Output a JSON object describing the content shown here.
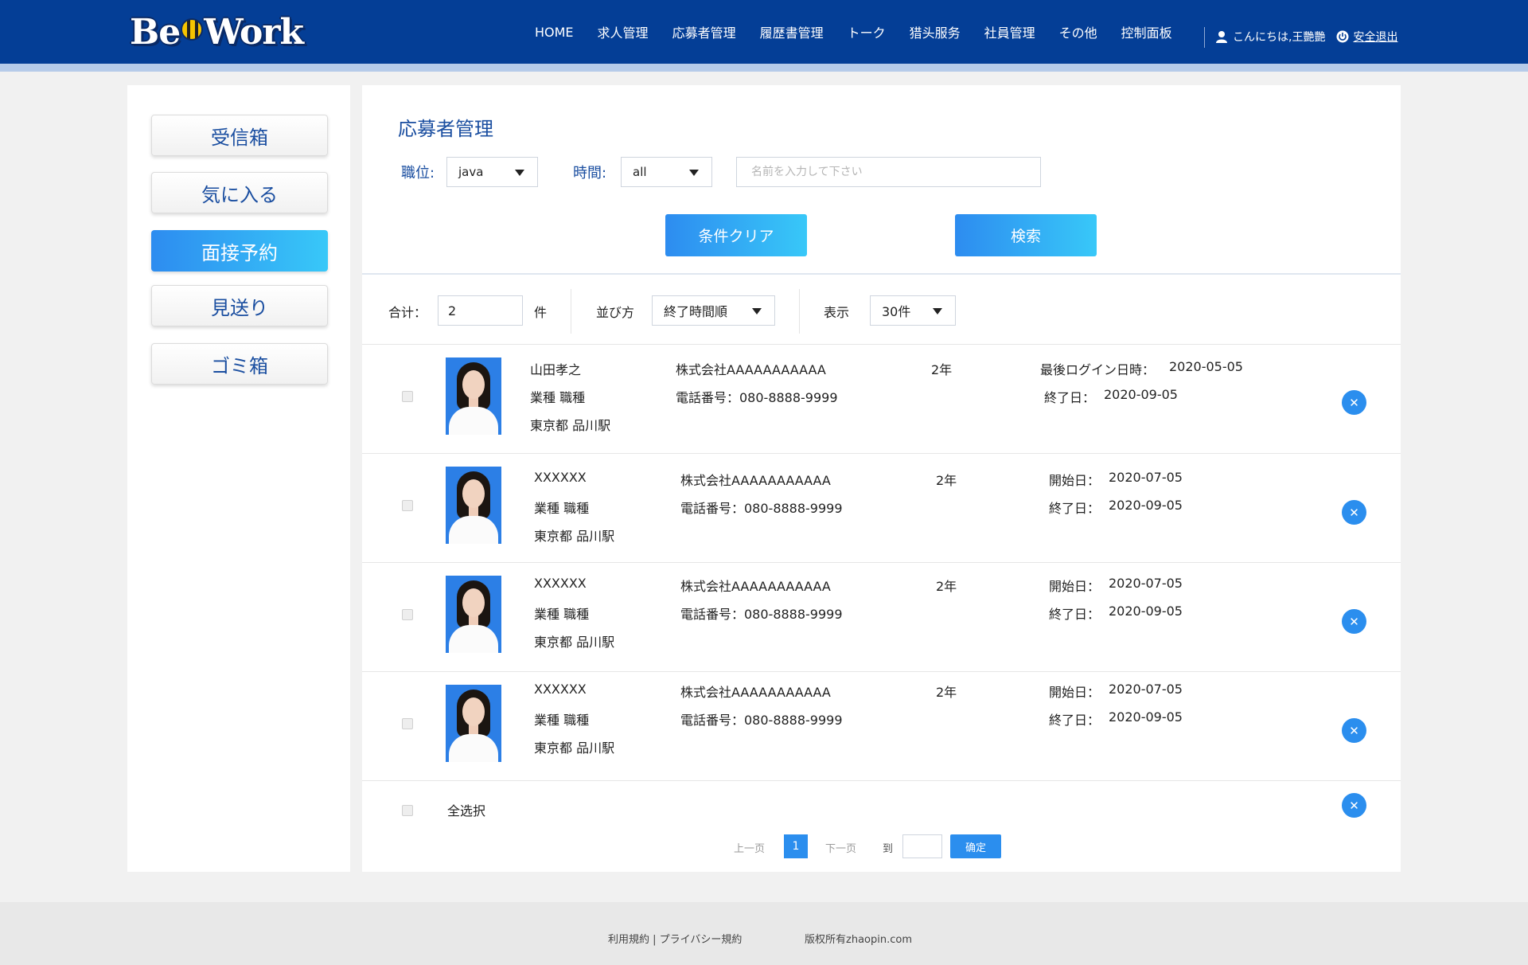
{
  "header": {
    "logo_text_1": "Be",
    "logo_text_2": "Work",
    "nav": [
      "HOME",
      "求人管理",
      "応募者管理",
      "履歴書管理",
      "トーク",
      "猎头服务",
      "社員管理",
      "その他",
      "控制面板"
    ],
    "greeting": "こんにちは,王艷艷",
    "logout": "安全退出"
  },
  "sidebar": {
    "items": [
      {
        "label": "受信箱"
      },
      {
        "label": "気に入る"
      },
      {
        "label": "面接予約"
      },
      {
        "label": "見送り"
      },
      {
        "label": "ゴミ箱"
      }
    ],
    "active_index": 2
  },
  "main": {
    "title": "応募者管理",
    "filters": {
      "position_label": "職位:",
      "position_value": "java",
      "time_label": "時間:",
      "time_value": "all",
      "name_placeholder": "名前を入力して下さい",
      "clear_button": "条件クリア",
      "search_button": "検索"
    },
    "summary": {
      "total_label": "合计：",
      "total_value": "2",
      "total_unit": "件",
      "sort_label": "並び方",
      "sort_value": "終了時間順",
      "display_label": "表示",
      "display_value": "30件"
    },
    "rows": [
      {
        "name": "山田孝之",
        "job": "業種 職種",
        "location": "東京都 品川駅",
        "company": "株式会社AAAAAAAAAAA",
        "phone": "電話番号：080-8888-9999",
        "years": "2年",
        "date1_label": "最後ログイン日時：",
        "date1_value": "2020-05-05",
        "date2_label": "終了日：",
        "date2_value": "2020-09-05"
      },
      {
        "name": "XXXXXX",
        "job": "業種 職種",
        "location": "東京都 品川駅",
        "company": "株式会社AAAAAAAAAAA",
        "phone": "電話番号：080-8888-9999",
        "years": "2年",
        "date1_label": "開始日：",
        "date1_value": "2020-07-05",
        "date2_label": "終了日：",
        "date2_value": "2020-09-05"
      },
      {
        "name": "XXXXXX",
        "job": "業種 職種",
        "location": "東京都 品川駅",
        "company": "株式会社AAAAAAAAAAA",
        "phone": "電話番号：080-8888-9999",
        "years": "2年",
        "date1_label": "開始日：",
        "date1_value": "2020-07-05",
        "date2_label": "終了日：",
        "date2_value": "2020-09-05"
      },
      {
        "name": "XXXXXX",
        "job": "業種 職種",
        "location": "東京都 品川駅",
        "company": "株式会社AAAAAAAAAAA",
        "phone": "電話番号：080-8888-9999",
        "years": "2年",
        "date1_label": "開始日：",
        "date1_value": "2020-07-05",
        "date2_label": "終了日：",
        "date2_value": "2020-09-05"
      }
    ],
    "select_all": "全选択",
    "pagination": {
      "prev": "上一页",
      "current": "1",
      "next": "下一页",
      "goto": "到",
      "confirm": "确定"
    }
  },
  "footer": {
    "links": "利用規約 | プライバシー規約",
    "copyright": "版权所有zhaopin.com"
  },
  "colors": {
    "header_bg": "#043e96",
    "accent_blue": "#2b8eee",
    "title_blue": "#1a4ea0"
  }
}
